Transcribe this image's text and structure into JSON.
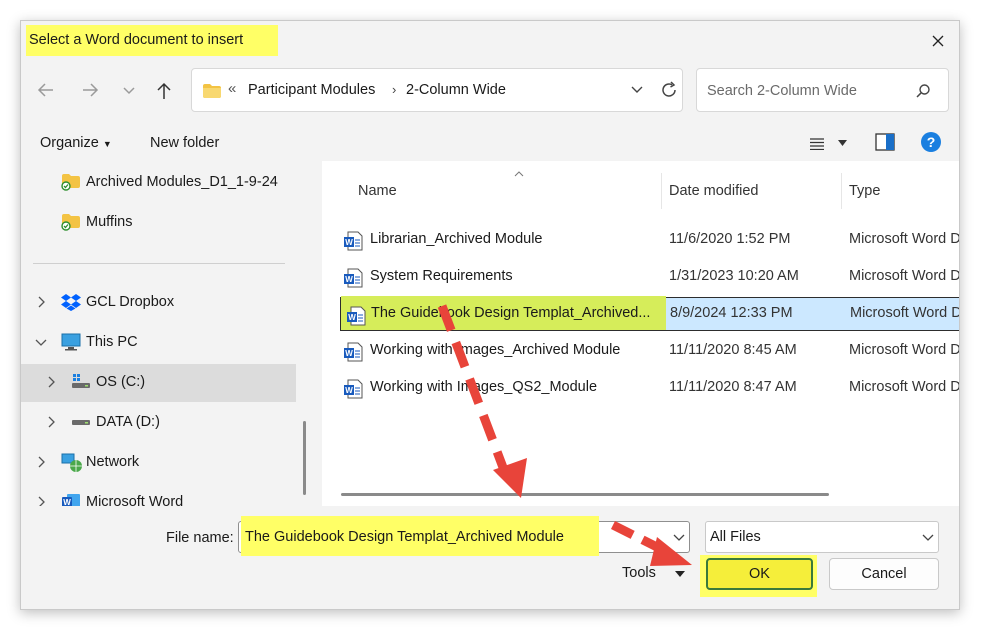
{
  "dialog": {
    "title": "Select a Word document to insert"
  },
  "address": {
    "overflow": "«",
    "crumbs": [
      "Participant Modules",
      "2-Column Wide"
    ]
  },
  "search": {
    "placeholder": "Search 2-Column Wide"
  },
  "toolbar": {
    "organize": "Organize",
    "new_folder": "New folder"
  },
  "sidebar": {
    "items": [
      {
        "label": "Archived Modules_D1_1-9-24",
        "icon": "synced-folder-icon"
      },
      {
        "label": "Muffins",
        "icon": "synced-folder-icon"
      },
      {
        "label": "GCL Dropbox",
        "icon": "dropbox-icon"
      },
      {
        "label": "This PC",
        "icon": "computer-icon"
      },
      {
        "label": "OS (C:)",
        "icon": "windows-drive-icon"
      },
      {
        "label": "DATA (D:)",
        "icon": "drive-icon"
      },
      {
        "label": "Network",
        "icon": "network-icon"
      },
      {
        "label": "Microsoft Word",
        "icon": "word-icon"
      }
    ]
  },
  "columns": {
    "name": "Name",
    "date": "Date modified",
    "type": "Type"
  },
  "files": [
    {
      "name": "Librarian_Archived Module",
      "date": "11/6/2020 1:52 PM",
      "type": "Microsoft Word D"
    },
    {
      "name": "System Requirements",
      "date": "1/31/2023 10:20 AM",
      "type": "Microsoft Word D"
    },
    {
      "name": "The Guidebook Design Templat_Archived...",
      "date": "8/9/2024 12:33 PM",
      "type": "Microsoft Word D"
    },
    {
      "name": "Working with Images_Archived Module",
      "date": "11/11/2020 8:45 AM",
      "type": "Microsoft Word D"
    },
    {
      "name": "Working with Images_QS2_Module",
      "date": "11/11/2020 8:47 AM",
      "type": "Microsoft Word D"
    }
  ],
  "footer": {
    "file_name_label": "File name:",
    "file_name_value": "The Guidebook Design Templat_Archived Module",
    "file_type": "All Files",
    "tools": "Tools",
    "ok": "OK",
    "cancel": "Cancel"
  },
  "colors": {
    "highlight_yellow": "#ffff66",
    "selection_blue": "#cce8ff",
    "arrow_red": "#e8443a",
    "accent_blue": "#0078d4"
  }
}
